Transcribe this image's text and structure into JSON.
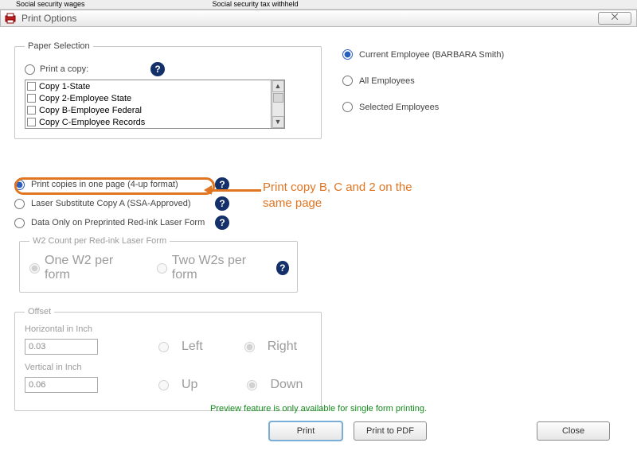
{
  "header": {
    "field1": "Social security wages",
    "field2": "Social security tax withheld"
  },
  "titlebar": {
    "title": "Print Options",
    "close_glyph": "⨉"
  },
  "paper_selection": {
    "legend": "Paper Selection",
    "print_a_copy_label": "Print a copy:",
    "copies": [
      "Copy 1-State",
      "Copy 2-Employee State",
      "Copy B-Employee Federal",
      "Copy C-Employee Records"
    ]
  },
  "formats": {
    "four_up": "Print copies in one page (4-up format)",
    "laser_sub": "Laser Substitute Copy A (SSA-Approved)",
    "data_only": "Data Only on Preprinted Red-ink Laser Form",
    "w2count_legend": "W2 Count per Red-ink Laser Form",
    "one_w2": "One W2 per form",
    "two_w2": "Two W2s per form"
  },
  "offset": {
    "legend": "Offset",
    "h_label": "Horizontal in Inch",
    "h_value": "0.03",
    "left": "Left",
    "right": "Right",
    "v_label": "Vertical in Inch",
    "v_value": "0.06",
    "up": "Up",
    "down": "Down"
  },
  "employees": {
    "current": "Current Employee (BARBARA Smith)",
    "all": "All Employees",
    "selected": "Selected Employees"
  },
  "annotation": "Print copy B, C and 2 on the same page",
  "preview_note": "Preview feature is only available for single form printing.",
  "buttons": {
    "print": "Print",
    "pdf": "Print to PDF",
    "close": "Close"
  },
  "help_glyph": "?"
}
